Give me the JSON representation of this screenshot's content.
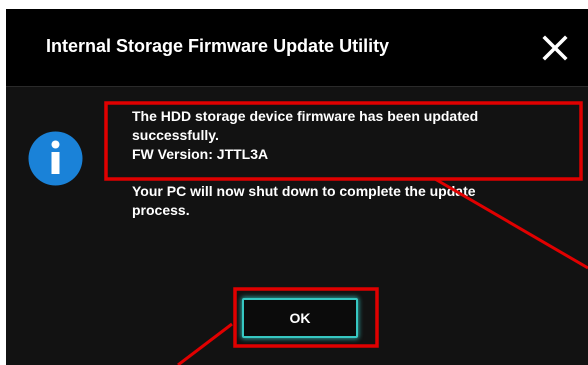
{
  "dialog": {
    "title": "Internal Storage Firmware Update Utility",
    "close_icon": "close-icon",
    "info_icon": "info-icon",
    "message": {
      "line1": "The HDD storage device firmware has been updated",
      "line2": "successfully.",
      "line3": "FW Version: JTTL3A",
      "line4": "Your PC will now shut down to complete the update",
      "line5": "process."
    },
    "ok_label": "OK"
  },
  "colors": {
    "title_bar": "#000000",
    "dialog_body": "#121212",
    "info_icon_blue": "#1a82d8",
    "button_glow": "#36c7c2",
    "annotation_red": "#e00000"
  }
}
